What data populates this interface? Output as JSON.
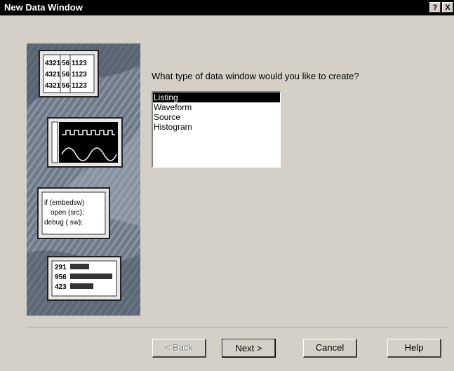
{
  "window": {
    "title": "New Data Window",
    "help_glyph": "?",
    "close_glyph": "X"
  },
  "illustration": {
    "listing": [
      [
        "4321",
        "56",
        "1123"
      ],
      [
        "4321",
        "56",
        "1123"
      ],
      [
        "4321",
        "56",
        "1123"
      ]
    ],
    "source_lines": [
      "if (embedsw)",
      "open (src);",
      "debug ( sw);"
    ],
    "histogram": [
      {
        "label": "291",
        "fraction": 0.45
      },
      {
        "label": "956",
        "fraction": 1.0
      },
      {
        "label": "423",
        "fraction": 0.55
      }
    ]
  },
  "prompt": "What type of data window would you like to create?",
  "list": {
    "items": [
      "Listing",
      "Waveform",
      "Source",
      "Histogram"
    ],
    "selected_index": 0
  },
  "buttons": {
    "back": "< Back",
    "next": "Next >",
    "cancel": "Cancel",
    "help": "Help"
  }
}
